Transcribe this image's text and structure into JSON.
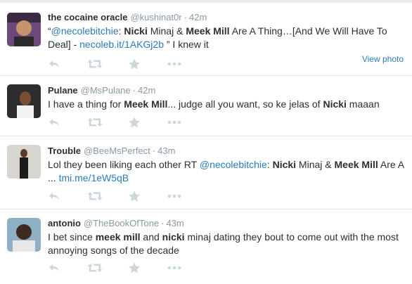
{
  "tweets": [
    {
      "fullname": "the cocaine oracle",
      "username": "@kushinat0r",
      "sep": "·",
      "time": "42m",
      "avatar": {
        "bg": "#6b4a7a",
        "skin": "#c6946b"
      },
      "text_parts": [
        {
          "t": "“",
          "s": "plain"
        },
        {
          "t": "@necolebitchie",
          "s": "link"
        },
        {
          "t": ": ",
          "s": "plain"
        },
        {
          "t": "Nicki",
          "s": "bold"
        },
        {
          "t": " Minaj & ",
          "s": "plain"
        },
        {
          "t": "Meek Mill",
          "s": "bold"
        },
        {
          "t": " Are A Thing…[And We Will Have To Deal] - ",
          "s": "plain"
        },
        {
          "t": "necoleb.it/1AKGj2b",
          "s": "link"
        },
        {
          "t": " ” I knew it",
          "s": "plain"
        }
      ],
      "view_photo": "View photo"
    },
    {
      "fullname": "Pulane",
      "username": "@MsPulane",
      "sep": "·",
      "time": "42m",
      "avatar": {
        "bg": "#2d2d2d",
        "skin": "#7a4e32"
      },
      "text_parts": [
        {
          "t": "I have a thing for ",
          "s": "plain"
        },
        {
          "t": "Meek Mill",
          "s": "bold"
        },
        {
          "t": "... judge all you want, so ke jelas of ",
          "s": "plain"
        },
        {
          "t": "Nicki",
          "s": "bold"
        },
        {
          "t": " maaan",
          "s": "plain"
        }
      ]
    },
    {
      "fullname": "Trouble",
      "username": "@BeeMsPerfect",
      "sep": "·",
      "time": "43m",
      "avatar": {
        "bg": "#d8d4cf",
        "skin": "#5a3a28"
      },
      "text_parts": [
        {
          "t": "Lol they been liking each other RT ",
          "s": "plain"
        },
        {
          "t": "@necolebitchie",
          "s": "link"
        },
        {
          "t": ": ",
          "s": "plain"
        },
        {
          "t": "Nicki",
          "s": "bold"
        },
        {
          "t": " Minaj & ",
          "s": "plain"
        },
        {
          "t": "Meek Mill",
          "s": "bold"
        },
        {
          "t": " Are A ... ",
          "s": "plain"
        },
        {
          "t": "tmi.me/1eW5qB",
          "s": "link"
        }
      ]
    },
    {
      "fullname": "antonio",
      "username": "@TheBookOfTone",
      "sep": "·",
      "time": "43m",
      "avatar": {
        "bg": "#8fb0c4",
        "skin": "#3e2a1e"
      },
      "text_parts": [
        {
          "t": "I bet since ",
          "s": "plain"
        },
        {
          "t": "meek mill",
          "s": "bold"
        },
        {
          "t": " and ",
          "s": "plain"
        },
        {
          "t": "nicki",
          "s": "bold"
        },
        {
          "t": " minaj dating they bout to come out with the most annoying songs of the decade",
          "s": "plain"
        }
      ]
    }
  ],
  "colors": {
    "link": "#2b7bb9",
    "meta": "#8899a6",
    "icon": "#ccd6dd"
  },
  "icons": [
    "reply-icon",
    "retweet-icon",
    "favorite-icon",
    "more-icon"
  ]
}
